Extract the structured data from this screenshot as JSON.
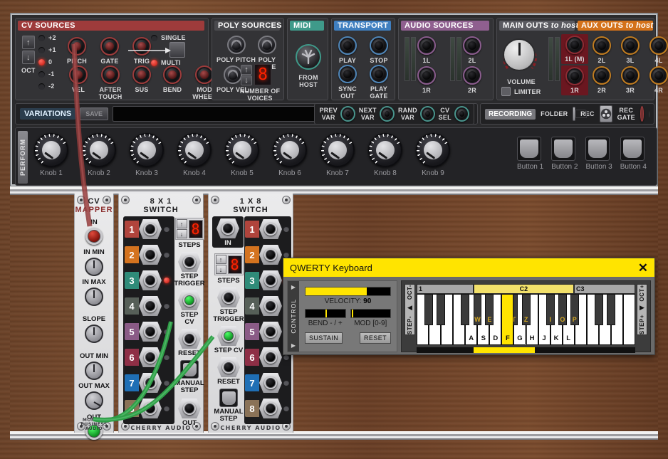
{
  "app": {
    "background": "#6b4228",
    "rack_rail_color": "#e8e8ea"
  },
  "panels": {
    "cv_sources": {
      "title": "CV SOURCES",
      "header_color": "#9e3b3b",
      "oct_label": "OCT",
      "oct_values": [
        "+2",
        "+1",
        "0",
        "-1",
        "-2"
      ],
      "oct_selected": "0",
      "jacks_row1": [
        "PITCH",
        "GATE",
        "TRIG"
      ],
      "jacks_row2": [
        "VEL",
        "AFTER TOUCH",
        "SUS",
        "BEND",
        "MOD WHEEL"
      ],
      "mode_single": "SINGLE",
      "mode_multi": "MULTI",
      "mode_selected": "MULTI"
    },
    "poly_sources": {
      "title": "POLY SOURCES",
      "header_color": "#4a4a4e",
      "jacks": [
        "POLY PITCH",
        "POLY GATE",
        "POLY VEL"
      ],
      "voices_label": "NUMBER OF VOICES",
      "voices_value": "8"
    },
    "midi": {
      "title": "MIDI",
      "header_color": "#3f9a8a",
      "jack_label": "FROM HOST"
    },
    "transport": {
      "title": "TRANSPORT",
      "header_color": "#3f7fc0",
      "jacks": [
        "PLAY",
        "STOP",
        "SYNC OUT",
        "PLAY GATE"
      ]
    },
    "audio_sources": {
      "title": "AUDIO SOURCES",
      "header_color": "#8f5f8f",
      "jacks": [
        "1L",
        "2L",
        "1R",
        "2R"
      ]
    },
    "main_outs": {
      "title": "MAIN OUTS",
      "title_italic": "to host",
      "header_color": "#5a5a60",
      "volume_label": "VOLUME",
      "limiter_label": "LIMITER",
      "jacks": [
        "1L (M)",
        "1R"
      ]
    },
    "aux_outs": {
      "title": "AUX OUTS",
      "title_italic": "to host",
      "header_color": "#d4721a",
      "jacks": [
        "2L",
        "3L",
        "4L",
        "2R",
        "3R",
        "4R"
      ]
    },
    "variations": {
      "title": "VARIATIONS",
      "save_label": "SAVE",
      "field_value": "",
      "prev_arrow": "←",
      "next_arrow": "→",
      "knobs": [
        "PREV VAR",
        "NEXT VAR",
        "RAND VAR",
        "CV SEL"
      ]
    },
    "recording": {
      "title": "RECORDING",
      "folder_label": "FOLDER",
      "rec_label": "REC",
      "rec_gate_label": "REC GATE"
    },
    "perform": {
      "tab_label": "PERFORM",
      "knobs": [
        "Knob 1",
        "Knob 2",
        "Knob 3",
        "Knob 4",
        "Knob 5",
        "Knob 6",
        "Knob 7",
        "Knob 8",
        "Knob 9"
      ],
      "buttons": [
        "Button 1",
        "Button 2",
        "Button 3",
        "Button 4"
      ]
    }
  },
  "modules": [
    {
      "id": "cv-mapper",
      "title_line1": "CV",
      "title_line2": "MAPPER",
      "brand": "MONKEY BUSINESS AUDIO",
      "controls": [
        {
          "label": "IN",
          "type": "jack",
          "state": "red"
        },
        {
          "label": "IN MIN",
          "type": "knob"
        },
        {
          "label": "IN MAX",
          "type": "knob"
        },
        {
          "label": "SLOPE",
          "type": "knob"
        },
        {
          "label": "OUT MIN",
          "type": "knob"
        },
        {
          "label": "OUT MAX",
          "type": "knob"
        },
        {
          "label": "OUT",
          "type": "jack",
          "state": "green"
        }
      ]
    },
    {
      "id": "switch-8x1",
      "title_line1": "8 X 1",
      "title_line2": "SWITCH",
      "brand": "CHERRY AUDIO",
      "channels": [
        {
          "num": "1",
          "color": "#b0443c",
          "active": false
        },
        {
          "num": "2",
          "color": "#d4731f",
          "active": false
        },
        {
          "num": "3",
          "color": "#2f8b79",
          "active": true
        },
        {
          "num": "4",
          "color": "#565f58",
          "active": false
        },
        {
          "num": "5",
          "color": "#8a5b86",
          "active": false
        },
        {
          "num": "6",
          "color": "#8e2f46",
          "active": false
        },
        {
          "num": "7",
          "color": "#1f6fb5",
          "active": false
        },
        {
          "num": "8",
          "color": "#8a7257",
          "active": false
        }
      ],
      "steps_label": "STEPS",
      "steps_value": "8",
      "step_trigger_label": "STEP TRIGGER",
      "step_cv_label": "STEP CV",
      "reset_label": "RESET",
      "manual_step_label": "MANUAL STEP",
      "out_label": "OUT"
    },
    {
      "id": "switch-1x8",
      "title_line1": "1 X 8",
      "title_line2": "SWITCH",
      "brand": "CHERRY AUDIO",
      "in_label": "IN",
      "channels": [
        {
          "num": "1",
          "color": "#b0443c",
          "active": false
        },
        {
          "num": "2",
          "color": "#d4731f",
          "active": false
        },
        {
          "num": "3",
          "color": "#2f8b79",
          "active": true
        },
        {
          "num": "4",
          "color": "#565f58",
          "active": false
        },
        {
          "num": "5",
          "color": "#8a5b86",
          "active": false
        },
        {
          "num": "6",
          "color": "#8e2f46",
          "active": false
        },
        {
          "num": "7",
          "color": "#1f6fb5",
          "active": false
        },
        {
          "num": "8",
          "color": "#8a7257",
          "active": false
        }
      ],
      "steps_label": "STEPS",
      "steps_value": "8",
      "step_trigger_label": "STEP TRIGGER",
      "step_cv_label": "STEP CV",
      "reset_label": "RESET",
      "manual_step_label": "MANUAL STEP"
    }
  ],
  "qwerty": {
    "title": "QWERTY Keyboard",
    "close_icon": "✕",
    "title_bg": "#ffe400",
    "control_tab_label": "CONTROL",
    "velocity_label": "VELOCITY:",
    "velocity_value": "90",
    "velocity_percent": 72,
    "bend_label": "BEND - / +",
    "mod_label": "MOD [0-9]",
    "sustain_label": "SUSTAIN",
    "reset_label": "RESET",
    "oct_minus": "OCT-",
    "oct_plus": "OCT+",
    "step_minus": "STEP-",
    "step_plus": "STEP+",
    "octave_markers": [
      "1",
      "C2",
      "C3"
    ],
    "selected_octave": "C2",
    "white_key_labels": [
      "",
      "",
      "",
      "",
      "A",
      "S",
      "D",
      "F",
      "G",
      "H",
      "J",
      "K",
      "L",
      "",
      "",
      "",
      "",
      ""
    ],
    "black_key_labels": [
      "",
      "",
      "",
      "W",
      "E",
      "",
      "T",
      "Z",
      "",
      "I",
      "O",
      "P",
      "",
      "",
      ""
    ],
    "selected_key": "F"
  }
}
